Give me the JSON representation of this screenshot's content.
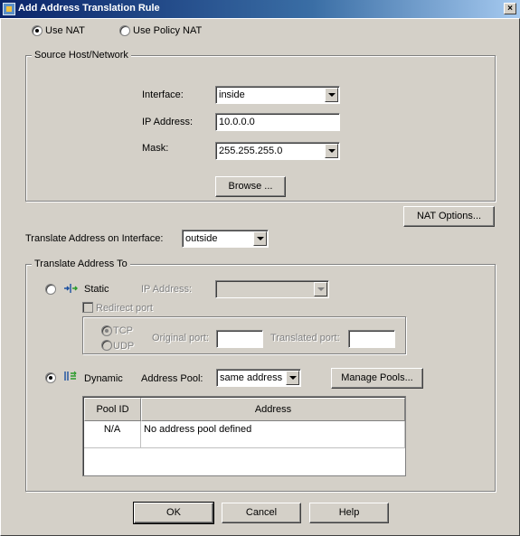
{
  "window": {
    "title": "Add Address Translation Rule",
    "close_glyph": "×"
  },
  "nat_mode": {
    "use_nat_label": "Use NAT",
    "use_policy_nat_label": "Use Policy NAT",
    "selected": "use_nat"
  },
  "source": {
    "legend": "Source Host/Network",
    "interface_label": "Interface:",
    "interface_value": "inside",
    "ip_label": "IP Address:",
    "ip_value": "10.0.0.0",
    "mask_label": "Mask:",
    "mask_value": "255.255.255.0",
    "browse_label": "Browse ..."
  },
  "nat_options_label": "NAT Options...",
  "translate_interface": {
    "label": "Translate Address on Interface:",
    "value": "outside"
  },
  "translate_to": {
    "legend": "Translate Address To",
    "static": {
      "label": "Static",
      "icon": "static-nat-icon",
      "ip_label": "IP Address:",
      "ip_value": "",
      "redirect_label": "Redirect port",
      "tcp_label": "TCP",
      "udp_label": "UDP",
      "original_port_label": "Original port:",
      "original_port_value": "",
      "translated_port_label": "Translated port:",
      "translated_port_value": ""
    },
    "dynamic": {
      "label": "Dynamic",
      "icon": "dynamic-nat-icon",
      "pool_label": "Address Pool:",
      "pool_value": "same address",
      "manage_pools_label": "Manage Pools..."
    },
    "selected": "dynamic",
    "table": {
      "columns": [
        "Pool ID",
        "Address"
      ],
      "rows": [
        {
          "pool_id": "N/A",
          "address": "No address pool defined"
        }
      ]
    }
  },
  "footer": {
    "ok_label": "OK",
    "cancel_label": "Cancel",
    "help_label": "Help"
  },
  "colors": {
    "dialog_bg": "#d4d0c8",
    "title_start": "#0a246a",
    "title_end": "#a6caf0",
    "disabled_text": "#808080"
  }
}
